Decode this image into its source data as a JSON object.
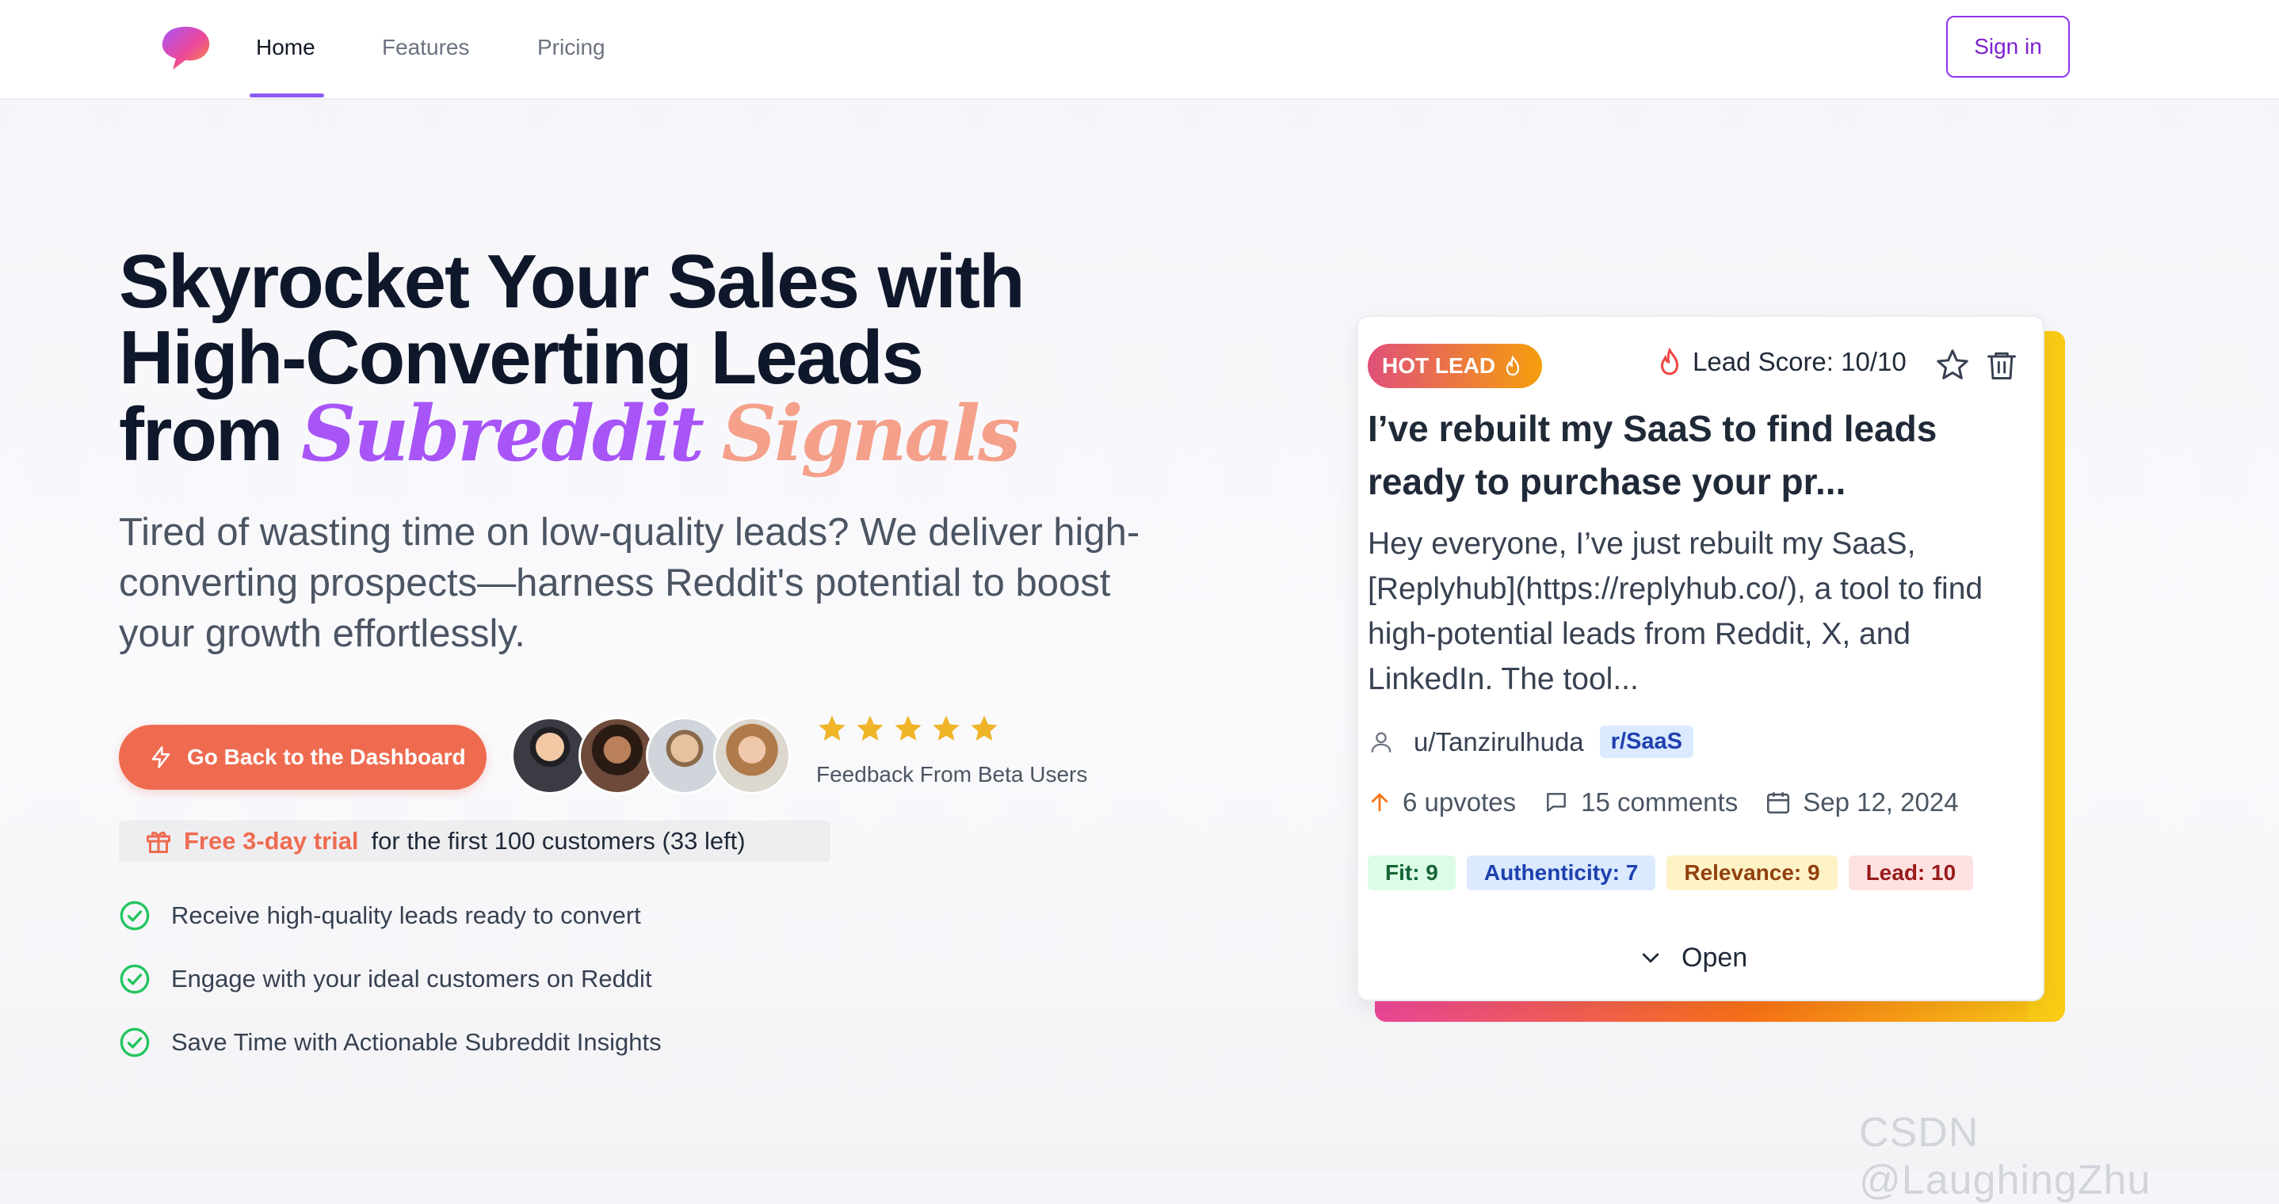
{
  "nav": {
    "links": [
      {
        "label": "Home",
        "active": true
      },
      {
        "label": "Features",
        "active": false
      },
      {
        "label": "Pricing",
        "active": false
      }
    ],
    "signin_label": "Sign in"
  },
  "hero": {
    "headline_line1": "Skyrocket Your Sales with",
    "headline_line2": "High-Converting Leads",
    "headline_line3_prefix": "from",
    "headline_script1": "Subreddit",
    "headline_script2": "Signals",
    "subtitle": "Tired of wasting time on low-quality leads? We deliver high-converting prospects—harness Reddit's potential to boost your growth effortlessly.",
    "cta_label": "Go Back to the Dashboard",
    "rating_stars": 5,
    "feedback_label": "Feedback From Beta Users",
    "trial_highlight": "Free 3-day trial",
    "trial_text": "for the first 100 customers (33 left)",
    "checklist": [
      "Receive high-quality leads ready to convert",
      "Engage with your ideal customers on Reddit",
      "Save Time with Actionable Subreddit Insights"
    ]
  },
  "card": {
    "badge": "HOT LEAD",
    "score_label": "Lead Score: 10/10",
    "title": "I’ve rebuilt my SaaS to find leads ready to purchase your pr...",
    "body": "Hey everyone, I’ve just rebuilt my SaaS, [Replyhub](https://replyhub.co/), a tool to find high-potential leads from Reddit, X, and LinkedIn. The tool...",
    "author": "u/Tanzirulhuda",
    "subreddit": "r/SaaS",
    "upvotes": "6 upvotes",
    "comments": "15 comments",
    "date": "Sep 12, 2024",
    "tags": {
      "fit": "Fit: 9",
      "authenticity": "Authenticity: 7",
      "relevance": "Relevance: 9",
      "lead": "Lead: 10"
    },
    "open_label": "Open"
  },
  "watermark": "CSDN @LaughingZhu",
  "colors": {
    "accent_purple": "#8b5cf6",
    "cta_orange": "#ef6b50",
    "star_gold": "#f0b429"
  },
  "icons": [
    "logo-icon",
    "zap-icon",
    "star-icon",
    "gift-icon",
    "check-circle-icon",
    "flame-icon",
    "star-outline-icon",
    "trash-icon",
    "user-icon",
    "arrow-up-icon",
    "comment-icon",
    "calendar-icon",
    "chevron-down-icon"
  ]
}
